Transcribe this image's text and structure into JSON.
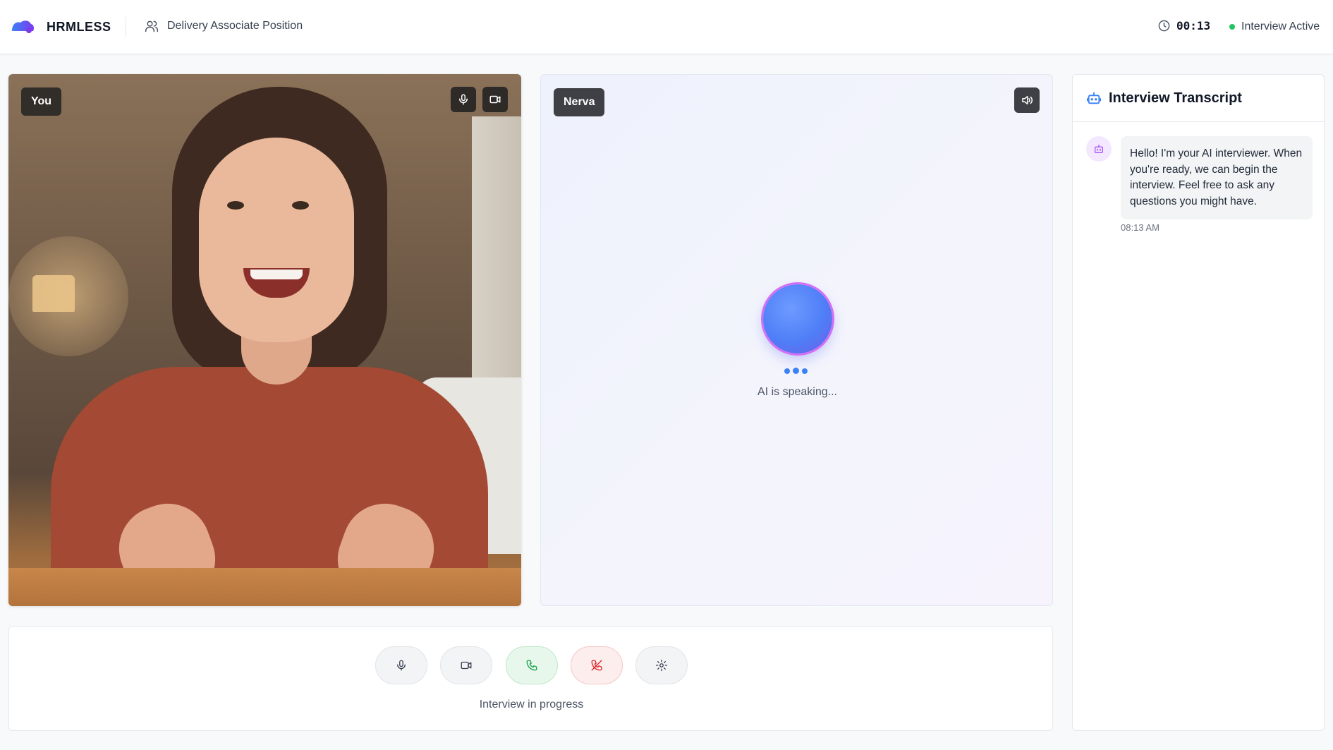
{
  "header": {
    "brand": "HRMLESS",
    "position": "Delivery Associate Position",
    "timer": "00:13",
    "status": "Interview Active"
  },
  "user_panel": {
    "label": "You",
    "icons": [
      "microphone-icon",
      "video-camera-icon"
    ]
  },
  "ai_panel": {
    "label": "Nerva",
    "icons": [
      "speaker-icon"
    ],
    "status": "AI is speaking..."
  },
  "controls": {
    "buttons": [
      "microphone-icon",
      "video-camera-icon",
      "phone-icon",
      "phone-off-icon",
      "settings-gear-icon"
    ],
    "status": "Interview in progress"
  },
  "transcript": {
    "title": "Interview Transcript",
    "messages": [
      {
        "sender_icon": "bot-icon",
        "text": "Hello! I'm your AI interviewer. When you're ready, we can begin the interview. Feel free to ask any questions you might have.",
        "time": "08:13 AM"
      }
    ]
  },
  "colors": {
    "accent_blue": "#3b82f6",
    "status_green": "#22c55e",
    "end_call_red": "#dc2626",
    "call_green": "#16a34a",
    "bot_purple": "#a855f7"
  }
}
